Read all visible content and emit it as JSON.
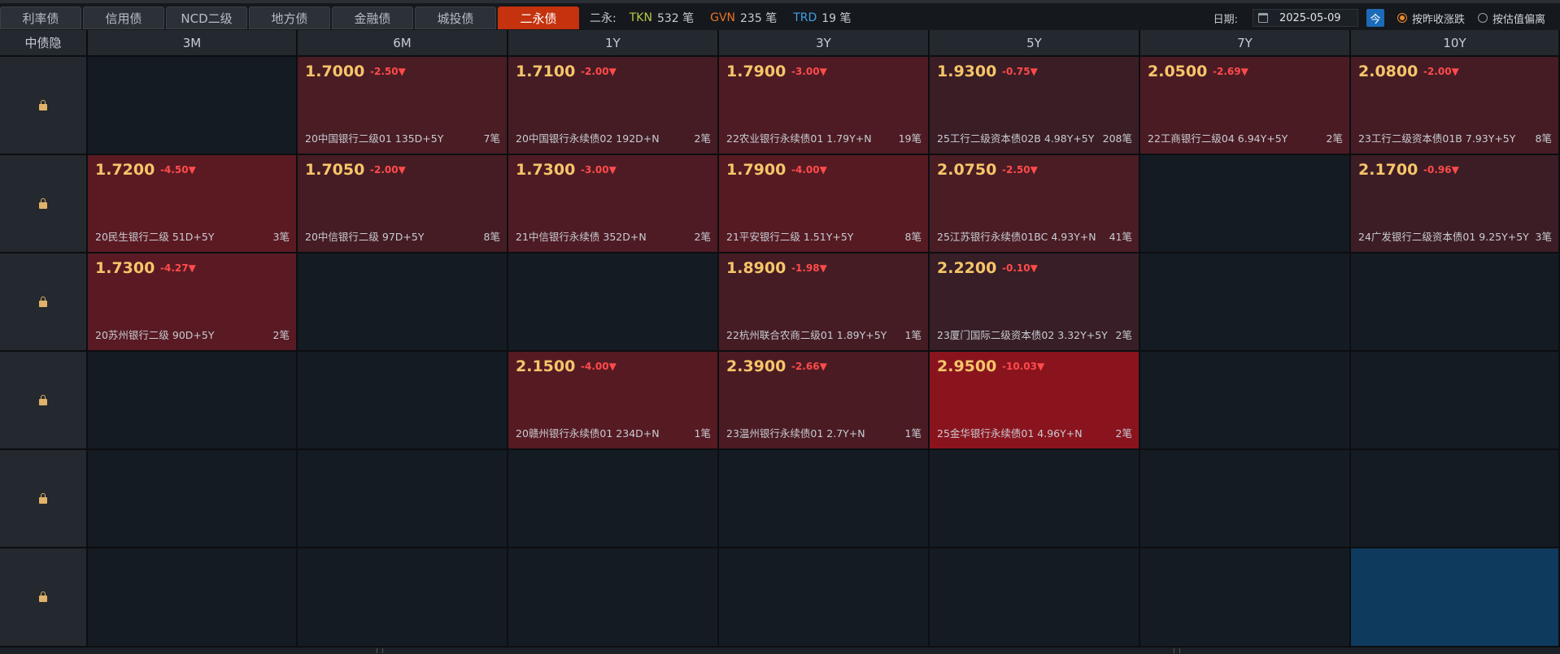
{
  "tabs": [
    {
      "label": "利率债",
      "active": false
    },
    {
      "label": "信用债",
      "active": false
    },
    {
      "label": "NCD二级",
      "active": false
    },
    {
      "label": "地方债",
      "active": false
    },
    {
      "label": "金融债",
      "active": false
    },
    {
      "label": "城投债",
      "active": false
    },
    {
      "label": "二永债",
      "active": true
    }
  ],
  "stats": {
    "label": "二永:",
    "tkn_key": "TKN",
    "tkn_value": "532 笔",
    "gvn_key": "GVN",
    "gvn_value": "235 笔",
    "trd_key": "TRD",
    "trd_value": "19 笔"
  },
  "controls": {
    "date_label": "日期:",
    "date_value": "2025-05-09",
    "today_label": "今",
    "radio1": "按昨收涨跌",
    "radio2": "按估值偏离",
    "selected_radio": 1
  },
  "grid": {
    "corner": "中债隐",
    "columns": [
      "3M",
      "6M",
      "1Y",
      "3Y",
      "5Y",
      "7Y",
      "10Y"
    ],
    "rows": [
      {
        "cells": [
          null,
          {
            "price": "1.7000",
            "chg": "-2.50▼",
            "name": "20中国银行二级01 135D+5Y",
            "count": "7笔",
            "intensity": 0.25
          },
          {
            "price": "1.7100",
            "chg": "-2.00▼",
            "name": "20中国银行永续债02 192D+N",
            "count": "2笔",
            "intensity": 0.2
          },
          {
            "price": "1.7900",
            "chg": "-3.00▼",
            "name": "22农业银行永续债01 1.79Y+N",
            "count": "19笔",
            "intensity": 0.3
          },
          {
            "price": "1.9300",
            "chg": "-0.75▼",
            "name": "25工行二级资本债02B 4.98Y+5Y",
            "count": "208笔",
            "intensity": 0.08
          },
          {
            "price": "2.0500",
            "chg": "-2.69▼",
            "name": "22工商银行二级04 6.94Y+5Y",
            "count": "2笔",
            "intensity": 0.27
          },
          {
            "price": "2.0800",
            "chg": "-2.00▼",
            "name": "23工行二级资本债01B 7.93Y+5Y",
            "count": "8笔",
            "intensity": 0.2
          }
        ]
      },
      {
        "cells": [
          {
            "price": "1.7200",
            "chg": "-4.50▼",
            "name": "20民生银行二级 51D+5Y",
            "count": "3笔",
            "intensity": 0.45
          },
          {
            "price": "1.7050",
            "chg": "-2.00▼",
            "name": "20中信银行二级 97D+5Y",
            "count": "8笔",
            "intensity": 0.2
          },
          {
            "price": "1.7300",
            "chg": "-3.00▼",
            "name": "21中信银行永续债 352D+N",
            "count": "2笔",
            "intensity": 0.3
          },
          {
            "price": "1.7900",
            "chg": "-4.00▼",
            "name": "21平安银行二级 1.51Y+5Y",
            "count": "8笔",
            "intensity": 0.4
          },
          {
            "price": "2.0750",
            "chg": "-2.50▼",
            "name": "25江苏银行永续债01BC 4.93Y+N",
            "count": "41笔",
            "intensity": 0.25
          },
          null,
          {
            "price": "2.1700",
            "chg": "-0.96▼",
            "name": "24广发银行二级资本债01 9.25Y+5Y",
            "count": "3笔",
            "intensity": 0.1
          }
        ]
      },
      {
        "cells": [
          {
            "price": "1.7300",
            "chg": "-4.27▼",
            "name": "20苏州银行二级 90D+5Y",
            "count": "2笔",
            "intensity": 0.43
          },
          null,
          null,
          {
            "price": "1.8900",
            "chg": "-1.98▼",
            "name": "22杭州联合农商二级01 1.89Y+5Y",
            "count": "1笔",
            "intensity": 0.2
          },
          {
            "price": "2.2200",
            "chg": "-0.10▼",
            "name": "23厦门国际二级资本债02 3.32Y+5Y",
            "count": "2笔",
            "intensity": 0.05
          },
          null,
          null
        ]
      },
      {
        "cells": [
          null,
          null,
          {
            "price": "2.1500",
            "chg": "-4.00▼",
            "name": "20赣州银行永续债01 234D+N",
            "count": "1笔",
            "intensity": 0.4
          },
          {
            "price": "2.3900",
            "chg": "-2.66▼",
            "name": "23温州银行永续债01 2.7Y+N",
            "count": "1笔",
            "intensity": 0.27
          },
          {
            "price": "2.9500",
            "chg": "-10.03▼",
            "name": "25金华银行永续债01 4.96Y+N",
            "count": "2笔",
            "intensity": 1.0
          },
          null,
          null
        ]
      },
      {
        "cells": [
          null,
          null,
          null,
          null,
          null,
          null,
          null
        ]
      },
      {
        "cells": [
          null,
          null,
          null,
          null,
          null,
          null,
          "selected"
        ]
      }
    ]
  }
}
